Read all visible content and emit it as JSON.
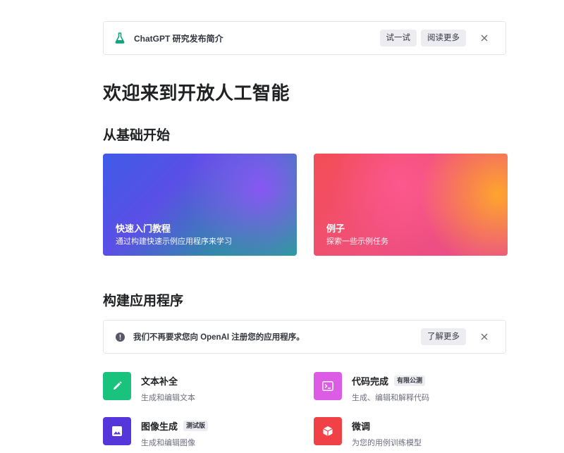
{
  "banner": {
    "icon": "flask-icon",
    "text": "ChatGPT 研究发布简介",
    "try_label": "试一试",
    "more_label": "阅读更多",
    "close_icon": "close-icon"
  },
  "page_title": "欢迎来到开放人工智能",
  "section_basics": {
    "title": "从基础开始",
    "cards": [
      {
        "title": "快速入门教程",
        "subtitle": "通过构建快速示例应用程序来学习"
      },
      {
        "title": "例子",
        "subtitle": "探索一些示例任务"
      }
    ]
  },
  "section_apps": {
    "title": "构建应用程序",
    "notice": {
      "icon": "info-icon",
      "text": "我们不再要求您向 OpenAI 注册您的应用程序。",
      "more_label": "了解更多",
      "close_icon": "close-icon"
    },
    "apps": [
      {
        "title": "文本补全",
        "desc": "生成和编辑文本",
        "badge": "",
        "icon": "pencil-icon",
        "color": "#19c37d"
      },
      {
        "title": "代码完成",
        "desc": "生成、编辑和解释代码",
        "badge": "有限公测",
        "icon": "terminal-icon",
        "color": "#dd5ce5"
      },
      {
        "title": "图像生成",
        "desc": "生成和编辑图像",
        "badge": "测试版",
        "icon": "image-icon",
        "color": "#5436da"
      },
      {
        "title": "微调",
        "desc": "为您的用例训练模型",
        "badge": "",
        "icon": "cube-icon",
        "color": "#ef4146"
      }
    ]
  },
  "colors": {
    "flask_green": "#10a37f",
    "text_dark": "#202123",
    "text_muted": "#6e6e80",
    "button_bg": "#ececf1"
  }
}
